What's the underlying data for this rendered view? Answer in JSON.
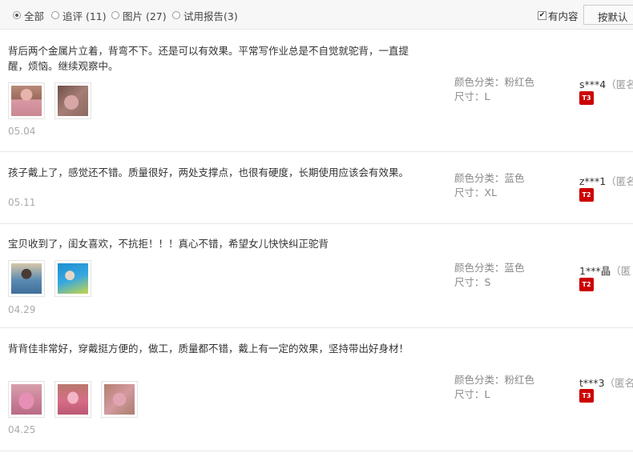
{
  "filters": [
    {
      "label": "全部",
      "selected": true
    },
    {
      "label": "追评 (11)",
      "selected": false
    },
    {
      "label": "图片 (27)",
      "selected": false
    },
    {
      "label": "试用报告(3)",
      "selected": false
    }
  ],
  "has_content_label": "有内容",
  "has_content_checked": true,
  "sort_label": "按默认",
  "reviews": [
    {
      "text": "背后两个金属片立着，背弯不下。还是可以有效果。平常写作业总是不自觉就驼背，一直提醒，烦恼。继续观察中。",
      "date": "05.04",
      "color_label": "颜色分类：",
      "color_value": "粉红色",
      "size_label": "尺寸：",
      "size_value": "L",
      "user": "s***4",
      "anon": "（匿名",
      "level_badge": "T3",
      "thumbs": [
        "thumb-pink-kid",
        "thumb-pink-dress"
      ]
    },
    {
      "text": "孩子戴上了，感觉还不错。质量很好，两处支撑点，也很有硬度，长期使用应该会有效果。",
      "date": "05.11",
      "color_label": "颜色分类：",
      "color_value": "蓝色",
      "size_label": "尺寸：",
      "size_value": "XL",
      "user": "z***1",
      "anon": "（匿名",
      "level_badge": "T2",
      "thumbs": []
    },
    {
      "text": "宝贝收到了，闺女喜欢，不抗拒！！！真心不错，希望女儿快快纠正驼背",
      "date": "04.29",
      "color_label": "颜色分类：",
      "color_value": "蓝色",
      "size_label": "尺寸：",
      "size_value": "S",
      "user": "1***晶",
      "anon": "（匿",
      "level_badge": "T2",
      "thumbs": [
        "thumb-blue-back",
        "thumb-blue-pool"
      ]
    },
    {
      "text": "背背佳非常好，穿戴挺方便的，做工，质量都不错，戴上有一定的效果，坚持带出好身材！",
      "date": "04.25",
      "color_label": "颜色分类：",
      "color_value": "粉红色",
      "size_label": "尺寸：",
      "size_value": "L",
      "user": "t***3",
      "anon": "（匿名",
      "level_badge": "T3",
      "thumbs": [
        "thumb-pink-front",
        "thumb-pink-side",
        "thumb-pink-blur"
      ]
    }
  ]
}
